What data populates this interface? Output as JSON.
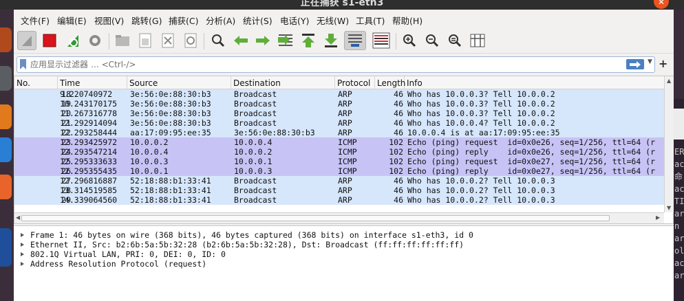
{
  "window": {
    "title": "正在捕获 s1-eth3"
  },
  "menu": [
    {
      "label": "文件(F)"
    },
    {
      "label": "编辑(E)"
    },
    {
      "label": "视图(V)"
    },
    {
      "label": "跳转(G)"
    },
    {
      "label": "捕获(C)"
    },
    {
      "label": "分析(A)"
    },
    {
      "label": "统计(S)"
    },
    {
      "label": "电话(Y)"
    },
    {
      "label": "无线(W)"
    },
    {
      "label": "工具(T)"
    },
    {
      "label": "帮助(H)"
    }
  ],
  "toolbar_icons": [
    "shark-fin-start-icon",
    "stop-capture-icon",
    "restart-capture-icon",
    "capture-options-gear-icon",
    "open-file-icon",
    "save-file-icon",
    "close-file-icon",
    "reload-file-icon",
    "find-packet-icon",
    "go-back-icon",
    "go-forward-icon",
    "go-to-packet-icon",
    "first-packet-icon",
    "last-packet-icon",
    "auto-scroll-icon",
    "colorize-icon",
    "zoom-in-icon",
    "zoom-out-icon",
    "zoom-normal-icon",
    "resize-columns-icon"
  ],
  "filter": {
    "placeholder": "应用显示过滤器 … <Ctrl-/>"
  },
  "columns": {
    "no": "No.",
    "time": "Time",
    "source": "Source",
    "destination": "Destination",
    "protocol": "Protocol",
    "length": "Length",
    "info": "Info"
  },
  "colors": {
    "arp_row": "#d6e6fb",
    "icmp_row": "#c7c3f5",
    "selection": "#d6e6fb"
  },
  "packets": [
    {
      "no": "18",
      "time": "9.220740972",
      "src": "3e:56:0e:88:30:b3",
      "dst": "Broadcast",
      "proto": "ARP",
      "len": "46",
      "info": "Who has 10.0.0.3? Tell 10.0.0.2",
      "type": "arp"
    },
    {
      "no": "19",
      "time": "10.243170175",
      "src": "3e:56:0e:88:30:b3",
      "dst": "Broadcast",
      "proto": "ARP",
      "len": "46",
      "info": "Who has 10.0.0.3? Tell 10.0.0.2",
      "type": "arp"
    },
    {
      "no": "20",
      "time": "11.267316778",
      "src": "3e:56:0e:88:30:b3",
      "dst": "Broadcast",
      "proto": "ARP",
      "len": "46",
      "info": "Who has 10.0.0.3? Tell 10.0.0.2",
      "type": "arp"
    },
    {
      "no": "21",
      "time": "12.292914094",
      "src": "3e:56:0e:88:30:b3",
      "dst": "Broadcast",
      "proto": "ARP",
      "len": "46",
      "info": "Who has 10.0.0.4? Tell 10.0.0.2",
      "type": "arp"
    },
    {
      "no": "22",
      "time": "12.293258444",
      "src": "aa:17:09:95:ee:35",
      "dst": "3e:56:0e:88:30:b3",
      "proto": "ARP",
      "len": "46",
      "info": "10.0.0.4 is at aa:17:09:95:ee:35",
      "type": "arp"
    },
    {
      "no": "23",
      "time": "12.293425972",
      "src": "10.0.0.2",
      "dst": "10.0.0.4",
      "proto": "ICMP",
      "len": "102",
      "info": "Echo (ping) request  id=0x0e26, seq=1/256, ttl=64 (r",
      "type": "icmp"
    },
    {
      "no": "24",
      "time": "12.293547214",
      "src": "10.0.0.4",
      "dst": "10.0.0.2",
      "proto": "ICMP",
      "len": "102",
      "info": "Echo (ping) reply    id=0x0e26, seq=1/256, ttl=64 (r",
      "type": "icmp"
    },
    {
      "no": "25",
      "time": "12.295333633",
      "src": "10.0.0.3",
      "dst": "10.0.0.1",
      "proto": "ICMP",
      "len": "102",
      "info": "Echo (ping) request  id=0x0e27, seq=1/256, ttl=64 (r",
      "type": "icmp"
    },
    {
      "no": "26",
      "time": "12.295355435",
      "src": "10.0.0.1",
      "dst": "10.0.0.3",
      "proto": "ICMP",
      "len": "102",
      "info": "Echo (ping) reply    id=0x0e27, seq=1/256, ttl=64 (r",
      "type": "icmp"
    },
    {
      "no": "27",
      "time": "12.296816887",
      "src": "52:18:88:b1:33:41",
      "dst": "Broadcast",
      "proto": "ARP",
      "len": "46",
      "info": "Who has 10.0.0.2? Tell 10.0.0.3",
      "type": "arp"
    },
    {
      "no": "28",
      "time": "13.314519585",
      "src": "52:18:88:b1:33:41",
      "dst": "Broadcast",
      "proto": "ARP",
      "len": "46",
      "info": "Who has 10.0.0.2? Tell 10.0.0.3",
      "type": "arp"
    },
    {
      "no": "29",
      "time": "14.339064560",
      "src": "52:18:88:b1:33:41",
      "dst": "Broadcast",
      "proto": "ARP",
      "len": "46",
      "info": "Who has 10.0.0.2? Tell 10.0.0.3",
      "type": "arp"
    }
  ],
  "details": [
    "Frame 1: 46 bytes on wire (368 bits), 46 bytes captured (368 bits) on interface s1-eth3, id 0",
    "Ethernet II, Src: b2:6b:5a:5b:32:28 (b2:6b:5a:5b:32:28), Dst: Broadcast (ff:ff:ff:ff:ff:ff)",
    "802.1Q Virtual LAN, PRI: 0, DEI: 0, ID: 0",
    "Address Resolution Protocol (request)"
  ],
  "right_window_text": [
    "ER",
    "ac",
    "命",
    "ac",
    "TI",
    "ar",
    "",
    "n",
    "ar",
    "ol",
    "ac",
    "ar"
  ]
}
